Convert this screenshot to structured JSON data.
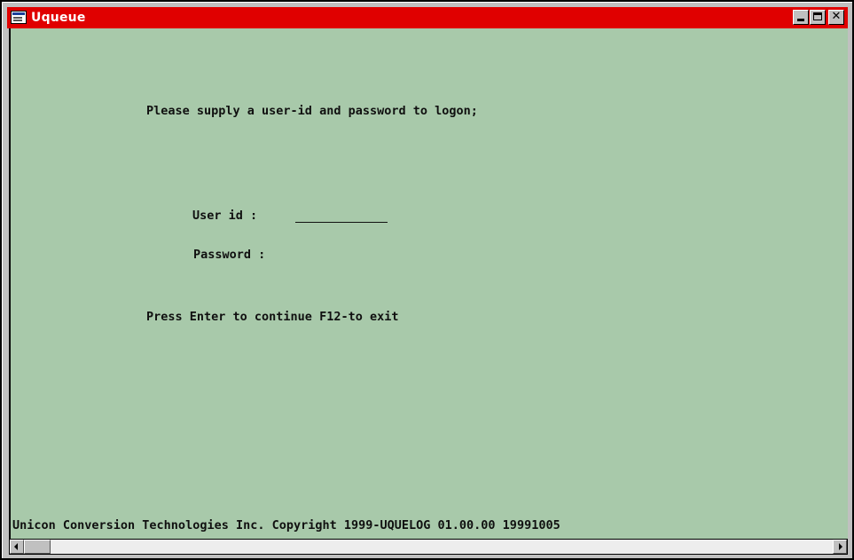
{
  "window": {
    "title": "Uqueue",
    "icon": "terminal-app-icon",
    "controls": {
      "minimize": "minimize-icon",
      "maximize": "maximize-icon",
      "close_glyph": "✕"
    },
    "colors": {
      "titlebar": "#e00000",
      "screen_background": "#a8c9aa",
      "text": "#101010"
    }
  },
  "screen": {
    "prompt": "Please supply a user-id and password to logon;",
    "userid_label": "User id :",
    "userid_value": "",
    "password_label": "Password :",
    "instructions": "Press Enter to continue F12-to exit",
    "copyright": "Unicon Conversion Technologies Inc. Copyright 1999-UQUELOG 01.00.00 19991005"
  }
}
